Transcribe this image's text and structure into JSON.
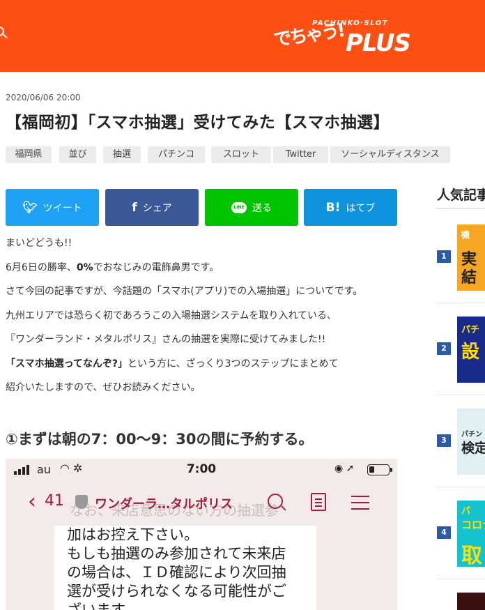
{
  "header": {
    "logo_sub": "PACHINKO·SLOT",
    "logo_jp": "でちゃう!",
    "logo_main": "PLUS",
    "bg_color": "#ff5014"
  },
  "article": {
    "date": "2020/06/06 20:00",
    "title": "【福岡初】「スマホ抽選」受けてみた【スマホ抽選】",
    "tags": [
      "福岡県",
      "並び",
      "抽選",
      "パチンコ",
      "スロット",
      "Twitter",
      "ソーシャルディスタンス"
    ],
    "share": {
      "twitter": "ツイート",
      "facebook": "シェア",
      "line": "送る",
      "hatena": "はてブ"
    },
    "lines": {
      "l1": "まいどどうも!!",
      "l2_pre": "6月6日の勝率、",
      "l2_bold": "0%",
      "l2_post": "でおなじみの電飾鼻男です。",
      "l3": "さて今回の記事ですが、今話題の「スマホ(アプリ)での入場抽選」についてです。",
      "l4": "九州エリアでは恐らく初であろうこの入場抽選システムを取り入れている、",
      "l5": "『ワンダーランド・メタルポリス』さんの抽選を実際に受けてみました!!",
      "l6_bold": "「スマホ抽選ってなんぞ?」",
      "l6_post": "という方に、ざっくり3つのステップにまとめて",
      "l7": "紹介いたしますので、ぜひお読みください。"
    },
    "heading1": "①まずは朝の7：00～9：30の間に予約する。"
  },
  "screenshot": {
    "carrier": "au",
    "time": "7:00",
    "back_count": "41",
    "nav_title": "ワンダーラ…タルポリス",
    "ghost_text": "なお、来店意思のない方の抽選参",
    "message_lines": [
      "加はお控え下さい。",
      "もしも抽選のみ参加されて未来店",
      "の場合は、ＩＤ確認により次回抽",
      "選が受けられなくなる可能性がご",
      "ざいます。"
    ]
  },
  "sidebar": {
    "title": "人気記事",
    "items": [
      {
        "rank": "1",
        "thumb_lines": [
          "機",
          "実",
          "結"
        ],
        "colors": [
          "#f5a623",
          "#ffffff",
          "#222222"
        ]
      },
      {
        "rank": "2",
        "thumb_lines": [
          "パチ",
          "設"
        ],
        "colors": [
          "#1a2a8a",
          "#ffe000",
          "#ffe000"
        ]
      },
      {
        "rank": "3",
        "thumb_lines": [
          "パチン",
          "検定"
        ],
        "colors": [
          "#e0f0f5",
          "#333333",
          "#222222"
        ]
      },
      {
        "rank": "4",
        "thumb_lines": [
          "パ",
          "コロナ",
          "取"
        ],
        "colors": [
          "#13c2cf",
          "#ffe000",
          "#ffe000"
        ]
      }
    ]
  }
}
